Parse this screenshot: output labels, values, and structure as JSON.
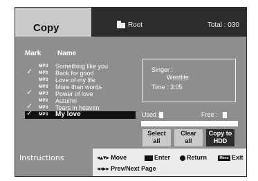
{
  "header": {
    "title": "Copy",
    "folder": "Root",
    "total": "Total : 030"
  },
  "columns": {
    "mark": "Mark",
    "name": "Name"
  },
  "tracks": [
    {
      "checked": false,
      "format": "MP3",
      "name": "Something like you"
    },
    {
      "checked": true,
      "format": "MP3",
      "name": "Back for good"
    },
    {
      "checked": false,
      "format": "MP3",
      "name": "Love of my life"
    },
    {
      "checked": false,
      "format": "MP3",
      "name": "More than words"
    },
    {
      "checked": true,
      "format": "MP3",
      "name": "Power of love"
    },
    {
      "checked": false,
      "format": "MP3",
      "name": "Autumn"
    },
    {
      "checked": true,
      "format": "MP3",
      "name": "Tears in heaven"
    },
    {
      "checked": true,
      "format": "MP3",
      "name": "My love",
      "selected": true
    }
  ],
  "info": {
    "singer_label": "Singer :",
    "singer_value": "Westlife",
    "time_text": "Time : 3:05"
  },
  "storage": {
    "used_label": "Used :",
    "free_label": "Free :"
  },
  "buttons": {
    "select_all": "Select\nall",
    "clear_all": "Clear\nall",
    "copy_to_hdd": "Copy to\nHDD"
  },
  "instructions": {
    "label": "Instructions",
    "move": "Move",
    "enter": "Enter",
    "return": "Return",
    "exit": "Exit",
    "menu_key": "Menu",
    "page": "Prev/Next Page"
  }
}
